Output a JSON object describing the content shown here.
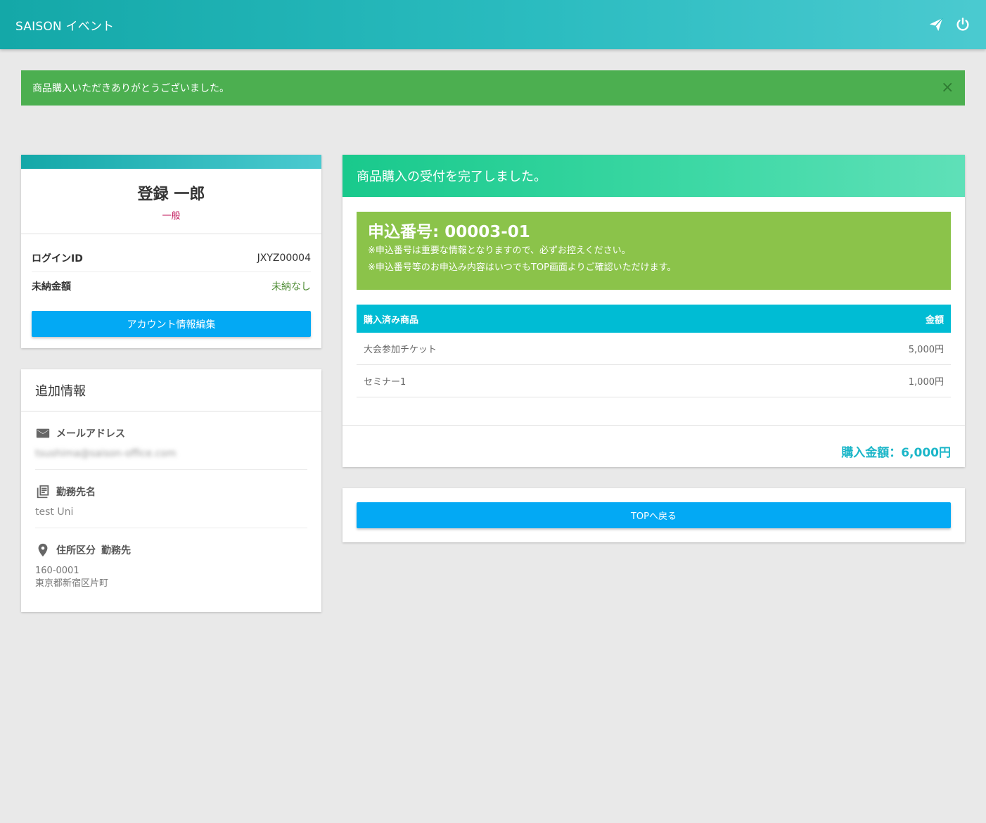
{
  "header": {
    "brand": "SAISON イベント",
    "icons": [
      "send-icon",
      "power-icon"
    ]
  },
  "alert": {
    "message": "商品購入いただきありがとうございました。",
    "close": "×"
  },
  "profile": {
    "name": "登録 一郎",
    "role": "一般",
    "login_label": "ログインID",
    "login_value": "JXYZ00004",
    "unpaid_label": "未納金額",
    "unpaid_value": "未納なし",
    "edit_button": "アカウント情報編集"
  },
  "extra": {
    "title": "追加情報",
    "email_label": "メールアドレス",
    "email_value": "tsushima@saison-office.com",
    "company_label": "勤務先名",
    "company_value": "test Uni",
    "address_label": "住所区分",
    "address_type": "勤務先",
    "postal": "160-0001",
    "address": "東京都新宿区片町"
  },
  "order": {
    "title": "商品購入の受付を完了しました。",
    "app_number": "申込番号: 00003-01",
    "note1": "※申込番号は重要な情報となりますので、必ずお控えください。",
    "note2": "※申込番号等のお申込み内容はいつでもTOP画面よりご確認いただけます。",
    "col_product": "購入済み商品",
    "col_amount": "金額",
    "rows": [
      {
        "product": "大会参加チケット",
        "amount": "5,000円"
      },
      {
        "product": "セミナー1",
        "amount": "1,000円"
      }
    ],
    "total": "購入金額：6,000円"
  },
  "back_button": "TOPへ戻る",
  "colors": {
    "header": "#14a8a8",
    "alert": "#4caf50",
    "button": "#03a9f4",
    "appbox": "#8bc34a",
    "table_header": "#00bcd4",
    "role": "#c2185b"
  }
}
